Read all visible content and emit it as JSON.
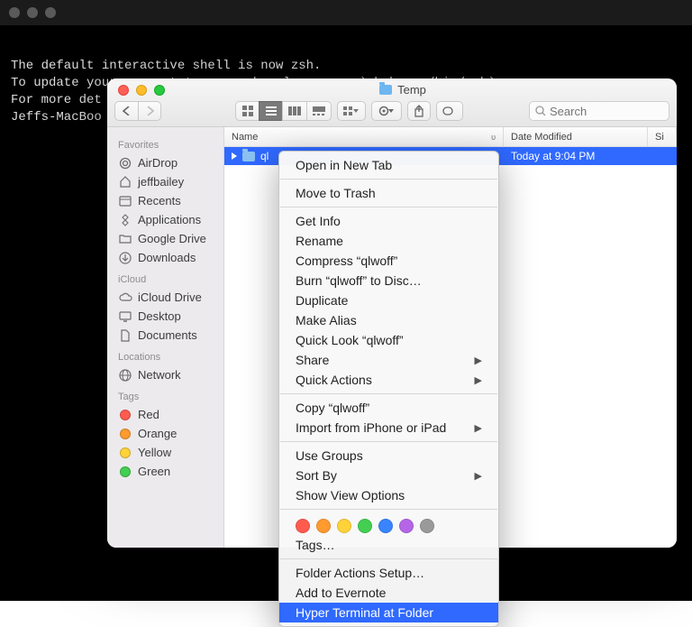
{
  "terminal": {
    "lines": "The default interactive shell is now zsh.\nTo update your account to use zsh, please run `chsh -s /bin/zsh`.\nFor more det\nJeffs-MacBoo"
  },
  "finder": {
    "title": "Temp",
    "search_placeholder": "Search",
    "sidebar": {
      "sections": [
        {
          "header": "Favorites",
          "items": [
            {
              "icon": "airdrop",
              "label": "AirDrop"
            },
            {
              "icon": "home",
              "label": "jeffbailey"
            },
            {
              "icon": "recents",
              "label": "Recents"
            },
            {
              "icon": "apps",
              "label": "Applications"
            },
            {
              "icon": "folder",
              "label": "Google Drive"
            },
            {
              "icon": "downloads",
              "label": "Downloads"
            }
          ]
        },
        {
          "header": "iCloud",
          "items": [
            {
              "icon": "cloud",
              "label": "iCloud Drive"
            },
            {
              "icon": "desktop",
              "label": "Desktop"
            },
            {
              "icon": "doc",
              "label": "Documents"
            }
          ]
        },
        {
          "header": "Locations",
          "items": [
            {
              "icon": "network",
              "label": "Network"
            }
          ]
        },
        {
          "header": "Tags",
          "items": [
            {
              "icon": "tag",
              "label": "Red",
              "color": "#ff5b4f"
            },
            {
              "icon": "tag",
              "label": "Orange",
              "color": "#ff9a2f"
            },
            {
              "icon": "tag",
              "label": "Yellow",
              "color": "#ffd23a"
            },
            {
              "icon": "tag",
              "label": "Green",
              "color": "#42cf52"
            }
          ]
        }
      ]
    },
    "columns": {
      "name": "Name",
      "date": "Date Modified",
      "size": "Si"
    },
    "rows": [
      {
        "name": "ql",
        "date": "Today at 9:04 PM"
      }
    ]
  },
  "context_menu": {
    "tag_colors": [
      "#ff5b4f",
      "#ff9a2f",
      "#ffd23a",
      "#42cf52",
      "#3a84ff",
      "#b466e6",
      "#9a9a9a"
    ],
    "items": [
      {
        "label": "Open in New Tab"
      },
      {
        "sep": true
      },
      {
        "label": "Move to Trash"
      },
      {
        "sep": true
      },
      {
        "label": "Get Info"
      },
      {
        "label": "Rename"
      },
      {
        "label": "Compress “qlwoff”"
      },
      {
        "label": "Burn “qlwoff” to Disc…"
      },
      {
        "label": "Duplicate"
      },
      {
        "label": "Make Alias"
      },
      {
        "label": "Quick Look “qlwoff”"
      },
      {
        "label": "Share",
        "submenu": true
      },
      {
        "label": "Quick Actions",
        "submenu": true
      },
      {
        "sep": true
      },
      {
        "label": "Copy “qlwoff”"
      },
      {
        "label": "Import from iPhone or iPad",
        "submenu": true
      },
      {
        "sep": true
      },
      {
        "label": "Use Groups"
      },
      {
        "label": "Sort By",
        "submenu": true
      },
      {
        "label": "Show View Options"
      },
      {
        "sep": true
      },
      {
        "tags": true
      },
      {
        "label": "Tags…"
      },
      {
        "sep": true
      },
      {
        "label": "Folder Actions Setup…"
      },
      {
        "label": "Add to Evernote"
      },
      {
        "label": "Hyper Terminal at Folder",
        "highlight": true
      }
    ]
  }
}
